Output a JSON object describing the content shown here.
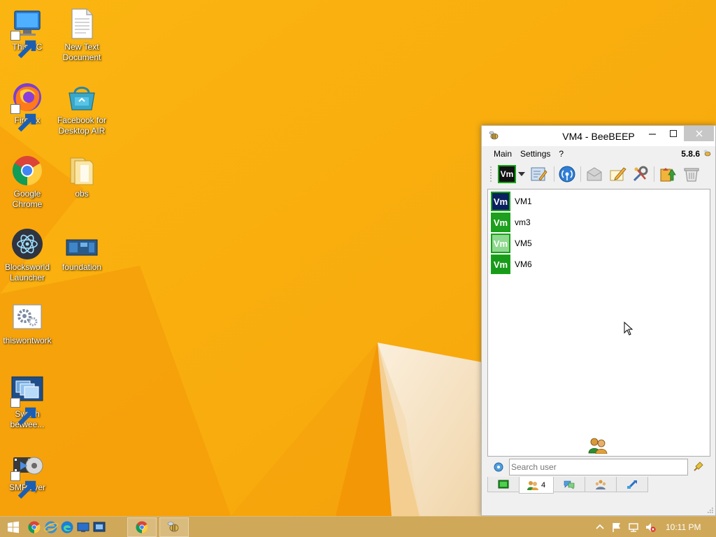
{
  "desktop": {
    "icons": [
      {
        "label": "This PC",
        "icon": "this-pc-icon"
      },
      {
        "label": "New Text Document",
        "icon": "text-document-icon"
      },
      {
        "label": "Firefox",
        "icon": "firefox-icon"
      },
      {
        "label": "Facebook for Desktop AIR",
        "icon": "facebook-air-icon"
      },
      {
        "label": "Google Chrome",
        "icon": "chrome-icon"
      },
      {
        "label": "obs",
        "icon": "folder-icon"
      },
      {
        "label": "Blocksworld Launcher",
        "icon": "blocksworld-icon"
      },
      {
        "label": "foundation",
        "icon": "foundation-icon"
      },
      {
        "label": "thiswontwork",
        "icon": "settings-file-icon"
      },
      {
        "label": "Switch betwee...",
        "icon": "switch-windows-icon"
      },
      {
        "label": "SMPlayer",
        "icon": "smplayer-icon"
      }
    ]
  },
  "beebeep": {
    "title": "VM4 - BeeBEEP",
    "version": "5.8.6",
    "menu": [
      "Main",
      "Settings",
      "?"
    ],
    "toolbar_status_label": "Vm",
    "users": [
      {
        "name": "VM1",
        "avatar": "Vm",
        "color": "#0b2060"
      },
      {
        "name": "vm3",
        "avatar": "Vm",
        "color": "#1f9e1f"
      },
      {
        "name": "VM5",
        "avatar": "Vm",
        "color": "#8fd88f"
      },
      {
        "name": "VM6",
        "avatar": "Vm",
        "color": "#1a9a1a"
      }
    ],
    "search": {
      "placeholder": "Search user",
      "value": ""
    },
    "tabs": {
      "users_count": "4"
    }
  },
  "taskbar": {
    "clock": "10:11 PM"
  },
  "colors": {
    "wallpaper": "#f7ae0c",
    "taskbar": "#cfa85a",
    "close_button": "#c7c7c7"
  }
}
